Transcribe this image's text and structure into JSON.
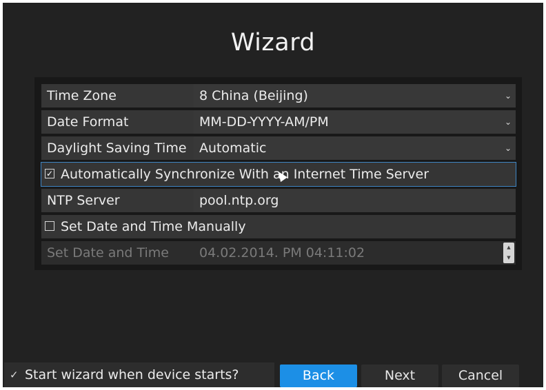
{
  "window": {
    "title": "Wizard"
  },
  "settings": {
    "time_zone": {
      "label": "Time Zone",
      "value": "8 China (Beijing)"
    },
    "date_format": {
      "label": "Date Format",
      "value": "MM-DD-YYYY-AM/PM"
    },
    "daylight_saving": {
      "label": "Daylight Saving Time",
      "value": "Automatic"
    },
    "auto_sync": {
      "label": "Automatically Synchronize With an Internet Time Server",
      "checked": true,
      "mark": "✓"
    },
    "ntp_server": {
      "label": "NTP Server",
      "value": "pool.ntp.org"
    },
    "manual": {
      "label": "Set Date and Time Manually",
      "checked": false
    },
    "set_datetime": {
      "label": "Set Date and Time",
      "value": "04.02.2014. PM 04:11:02"
    }
  },
  "footer": {
    "start_wizard": {
      "label": "Start wizard when device starts?",
      "checked": true,
      "mark": "✓"
    },
    "back_label": "Back",
    "next_label": "Next",
    "cancel_label": "Cancel"
  },
  "icons": {
    "dropdown": "chevron-down-icon",
    "spin_up": "▲",
    "spin_down": "▼"
  },
  "colors": {
    "background": "#222222",
    "accent": "#1c8fe6",
    "selection_outline": "#3f86c5"
  }
}
